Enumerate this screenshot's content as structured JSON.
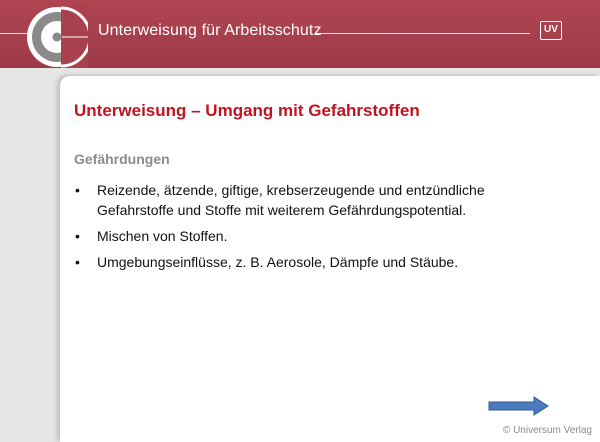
{
  "header": {
    "title": "Unterweisung für Arbeitsschutz",
    "badge": "UV",
    "logo_icon": "ring-logo-icon",
    "colors": {
      "bar": "#a8404d",
      "logo_gray": "#8a8a8a"
    }
  },
  "slide": {
    "title": "Unterweisung – Umgang mit Gefahrstoffen",
    "section_heading": "Gefährdungen",
    "bullets": [
      "Reizende, ätzende, giftige, krebserzeugende und entzündliche Gefahrstoffe und Stoffe mit weiterem Gefährdungspotential.",
      "Mischen von Stoffen.",
      "Umgebungseinflüsse, z. B. Aerosole, Dämpfe und Stäube."
    ],
    "bullet_symbol": "•",
    "colors": {
      "title": "#c0141f",
      "heading": "#8c8c8c"
    }
  },
  "navigation": {
    "next_icon": "arrow-right-icon",
    "color": "#4a7bbd"
  },
  "footer": {
    "copyright": "© Universum Verlag"
  }
}
